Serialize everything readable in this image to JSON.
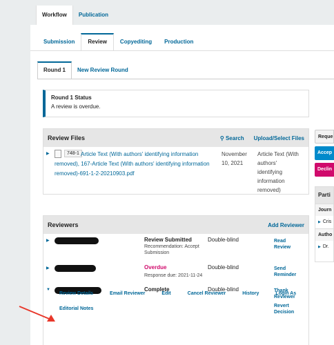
{
  "top_tabs": [
    "Workflow",
    "Publication"
  ],
  "stage_tabs": [
    "Submission",
    "Review",
    "Copyediting",
    "Production"
  ],
  "round_tabs": [
    "Round 1",
    "New Review Round"
  ],
  "status": {
    "title": "Round 1 Status",
    "text": "A review is overdue."
  },
  "review_files": {
    "title": "Review Files",
    "search_label": "Search",
    "upload_label": "Upload/Select Files",
    "file": {
      "id": "748-1",
      "name": "Article Text (With authors' identifying information removed), 167-Article Text (With authors' identifying information removed)-691-1-2-20210903.pdf",
      "date": "November 10, 2021",
      "type": "Article Text (With authors' identifying information removed)"
    }
  },
  "reviewers": {
    "title": "Reviewers",
    "add_label": "Add Reviewer",
    "rows": [
      {
        "status": "Review Submitted",
        "sub": "Recommendation: Accept Submission",
        "method": "Double-blind",
        "action": "Read Review"
      },
      {
        "status": "Overdue",
        "sub": "Response due: 2021-11-24",
        "method": "Double-blind",
        "action": "Send Reminder"
      },
      {
        "status": "Complete",
        "sub": "",
        "method": "Double-blind",
        "action": "Thank Reviewer",
        "action2": "Revert Decision"
      }
    ],
    "actions": [
      "Review Details",
      "Email Reviewer",
      "Edit",
      "Cancel Reviewer",
      "History",
      "Login As"
    ],
    "actions2": "Editorial Notes"
  },
  "sidebar": {
    "buttons": [
      "Reque",
      "Accep",
      "Declin"
    ],
    "participants_title": "Parti",
    "sections": [
      "Journ",
      "Autho"
    ],
    "items": [
      "Cris",
      "Dr."
    ]
  }
}
